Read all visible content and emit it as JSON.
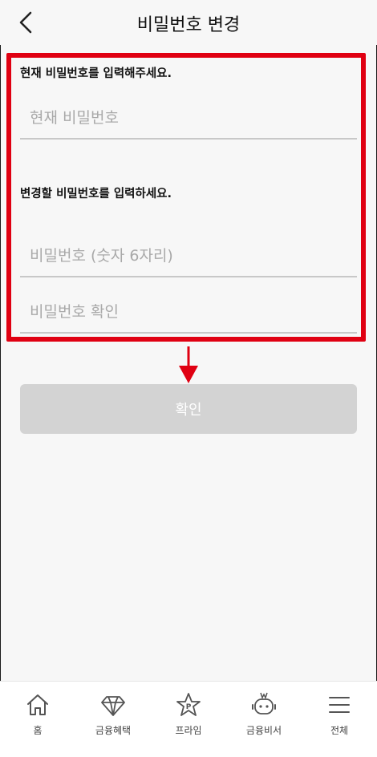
{
  "header": {
    "title": "비밀번호 변경"
  },
  "current_password": {
    "label": "현재 비밀번호를 입력해주세요.",
    "placeholder": "현재 비밀번호"
  },
  "new_password": {
    "label": "변경할 비밀번호를 입력하세요.",
    "placeholder": "비밀번호 (숫자 6자리)",
    "confirm_placeholder": "비밀번호 확인"
  },
  "confirm_button": {
    "label": "확인"
  },
  "bottom_nav": {
    "items": [
      {
        "label": "홈",
        "icon": "home-icon"
      },
      {
        "label": "금융혜택",
        "icon": "diamond-icon"
      },
      {
        "label": "프라임",
        "icon": "star-p-icon"
      },
      {
        "label": "금융비서",
        "icon": "robot-icon"
      },
      {
        "label": "전체",
        "icon": "menu-icon"
      }
    ]
  },
  "colors": {
    "highlight": "#e00012",
    "button_disabled": "#d3d3d3"
  }
}
